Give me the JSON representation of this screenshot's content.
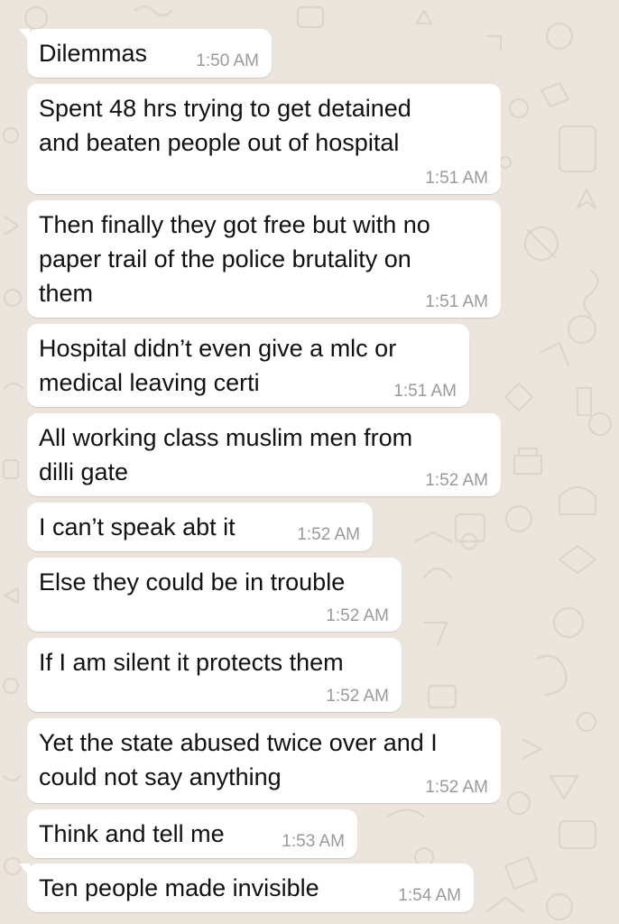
{
  "chat": {
    "messages": [
      {
        "text": "Dilemmas",
        "time": "1:50 AM"
      },
      {
        "text": "Spent 48 hrs trying to get detained\nand beaten people out of hospital",
        "time": "1:51 AM"
      },
      {
        "text": "Then finally they got free but with no\npaper trail of the police brutality on\nthem",
        "time": "1:51 AM"
      },
      {
        "text": "Hospital didn’t even give a mlc or\nmedical leaving certi",
        "time": "1:51 AM"
      },
      {
        "text": "All working class muslim men from\ndilli gate",
        "time": "1:52 AM"
      },
      {
        "text": "I can’t speak abt it",
        "time": "1:52 AM"
      },
      {
        "text": "Else they could be in trouble",
        "time": "1:52 AM"
      },
      {
        "text": "If I am silent it protects them",
        "time": "1:52 AM"
      },
      {
        "text": "Yet the state abused twice over and I\ncould not say anything",
        "time": "1:52 AM"
      },
      {
        "text": "Think and tell me",
        "time": "1:53 AM"
      },
      {
        "text": "Ten people made invisible",
        "time": "1:54 AM"
      }
    ]
  },
  "colors": {
    "background": "#ece5dd",
    "bubble": "#ffffff",
    "text": "#111111",
    "timestamp": "#9a9a9a"
  }
}
